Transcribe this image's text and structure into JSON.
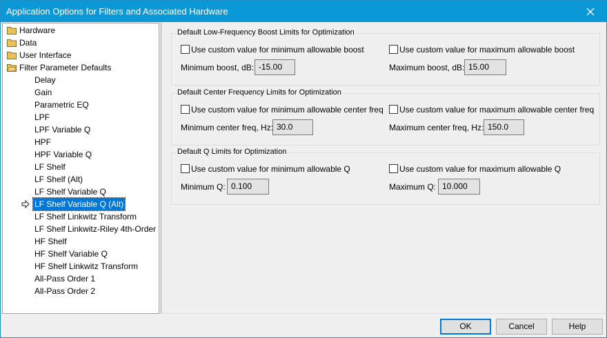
{
  "window": {
    "title": "Application Options for Filters and Associated Hardware"
  },
  "tree": {
    "folders": [
      {
        "label": "Hardware"
      },
      {
        "label": "Data"
      },
      {
        "label": "User Interface"
      },
      {
        "label": "Filter Parameter Defaults"
      }
    ],
    "children": [
      "Delay",
      "Gain",
      "Parametric EQ",
      "LPF",
      "LPF Variable Q",
      "HPF",
      "HPF Variable Q",
      "LF Shelf",
      "LF Shelf (Alt)",
      "LF Shelf Variable Q",
      "LF Shelf Variable Q (Alt)",
      "LF Shelf Linkwitz Transform",
      "LF Shelf Linkwitz-Riley 4th-Order",
      "HF Shelf",
      "HF Shelf Variable Q",
      "HF Shelf Linkwitz Transform",
      "All-Pass Order 1",
      "All-Pass Order 2"
    ],
    "selected": "LF Shelf Variable Q (Alt)"
  },
  "groups": {
    "boost": {
      "title": "Default Low-Frequency Boost Limits for Optimization",
      "min_check": "Use custom value for minimum allowable boost",
      "max_check": "Use custom value for maximum allowable boost",
      "min_label": "Minimum boost, dB:",
      "min_value": "-15.00",
      "max_label": "Maximum boost, dB:",
      "max_value": "15.00"
    },
    "freq": {
      "title": "Default Center Frequency Limits for Optimization",
      "min_check": "Use custom value for minimum allowable center freq",
      "max_check": "Use custom value for maximum allowable center freq",
      "min_label": "Minimum center freq, Hz:",
      "min_value": "30.0",
      "max_label": "Maximum center freq, Hz:",
      "max_value": "150.0"
    },
    "q": {
      "title": "Default Q Limits for Optimization",
      "min_check": "Use custom value for minimum allowable Q",
      "max_check": "Use custom value for maximum allowable Q",
      "min_label": "Minimum Q:",
      "min_value": "0.100",
      "max_label": "Maximum Q:",
      "max_value": "10.000"
    }
  },
  "buttons": {
    "ok": "OK",
    "cancel": "Cancel",
    "help": "Help"
  },
  "icons": {
    "close": "close-icon",
    "folder": "folder-icon",
    "pointer": "arrow-pointer-icon"
  },
  "colors": {
    "titlebar": "#0b98d6",
    "selection": "#0078d7",
    "default_button_border": "#0078d7",
    "folder": "#e8c25a"
  }
}
